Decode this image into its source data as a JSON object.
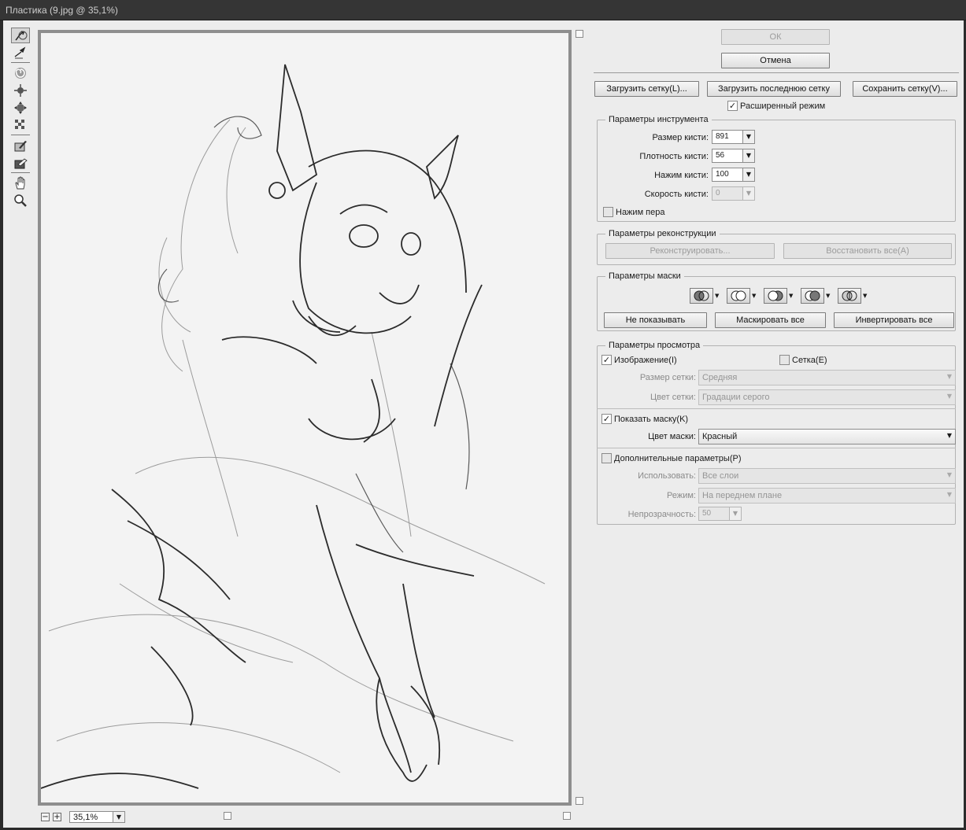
{
  "window": {
    "title": "Пластика (9.jpg @ 35,1%)"
  },
  "tools": [
    {
      "name": "forward-warp-tool-icon",
      "active": true
    },
    {
      "name": "reconstruct-tool-icon"
    },
    {
      "name": "twirl-clockwise-tool-icon"
    },
    {
      "name": "pucker-tool-icon"
    },
    {
      "name": "bloat-tool-icon"
    },
    {
      "name": "push-left-tool-icon"
    },
    {
      "name": "freeze-mask-tool-icon"
    },
    {
      "name": "thaw-mask-tool-icon"
    },
    {
      "name": "hand-tool-icon"
    },
    {
      "name": "zoom-tool-icon"
    }
  ],
  "status": {
    "zoom_out": "−",
    "zoom_in": "+",
    "zoom_value": "35,1%"
  },
  "actions": {
    "ok": "ОК",
    "cancel": "Отмена"
  },
  "mesh": {
    "load": "Загрузить сетку(L)...",
    "load_last": "Загрузить последнюю сетку",
    "save": "Сохранить сетку(V)...",
    "advanced_mode": "Расширенный режим"
  },
  "tool_options": {
    "title": "Параметры инструмента",
    "brush_size_label": "Размер кисти:",
    "brush_size": "891",
    "brush_density_label": "Плотность кисти:",
    "brush_density": "56",
    "brush_pressure_label": "Нажим кисти:",
    "brush_pressure": "100",
    "brush_rate_label": "Скорость кисти:",
    "brush_rate": "0",
    "stylus_pressure": "Нажим пера"
  },
  "reconstruct": {
    "title": "Параметры реконструкции",
    "reconstruct_btn": "Реконструировать...",
    "restore_all_btn": "Восстановить все(A)"
  },
  "mask": {
    "title": "Параметры маски",
    "none": "Не показывать",
    "mask_all": "Маскировать все",
    "invert_all": "Инвертировать все"
  },
  "view": {
    "title": "Параметры просмотра",
    "show_image": "Изображение(I)",
    "show_mesh": "Сетка(E)",
    "mesh_size_label": "Размер сетки:",
    "mesh_size": "Средняя",
    "mesh_color_label": "Цвет сетки:",
    "mesh_color": "Градации серого",
    "show_mask": "Показать маску(K)",
    "mask_color_label": "Цвет маски:",
    "mask_color": "Красный",
    "show_backdrop": "Дополнительные параметры(P)",
    "use_label": "Использовать:",
    "use": "Все слои",
    "mode_label": "Режим:",
    "mode": "На переднем плане",
    "opacity_label": "Непрозрачность:",
    "opacity": "50"
  },
  "colors": {
    "dialog_bg": "#ececec",
    "titlebar_bg": "#353535",
    "canvas_frame": "#8e8e8e"
  }
}
